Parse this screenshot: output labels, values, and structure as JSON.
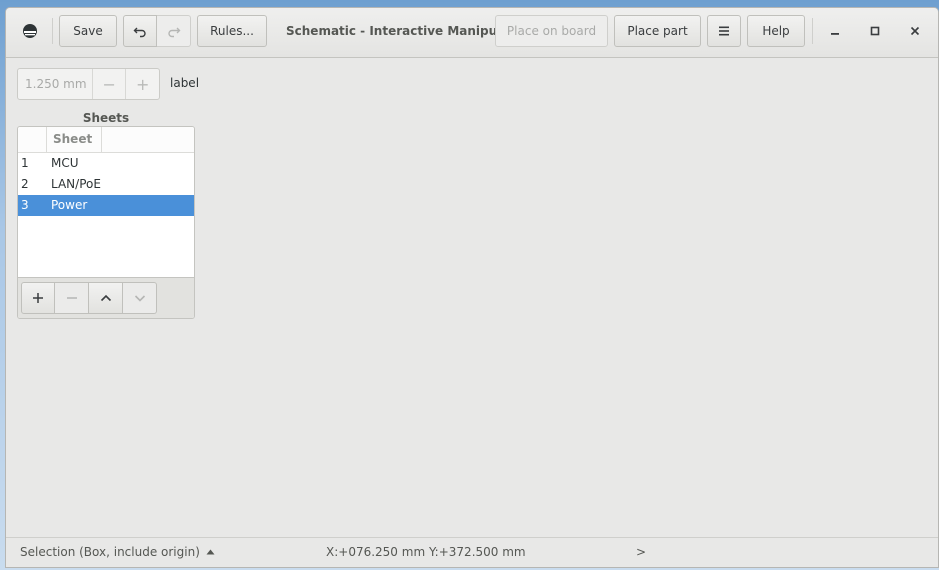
{
  "header": {
    "save_label": "Save",
    "rules_label": "Rules...",
    "title": "Schematic - Interactive Manipul...",
    "place_on_board_label": "Place on board",
    "place_part_label": "Place part",
    "help_label": "Help"
  },
  "toolbar": {
    "grid_value": "1.250 mm",
    "label_text": "label"
  },
  "sheets": {
    "title": "Sheets",
    "column_header": "Sheet",
    "rows": [
      {
        "num": "1",
        "name": "MCU"
      },
      {
        "num": "2",
        "name": "LAN/PoE"
      },
      {
        "num": "3",
        "name": "Power"
      }
    ],
    "selected_index": 2
  },
  "status": {
    "mode": "Selection (Box, include origin)",
    "coords": "X:+076.250 mm Y:+372.500 mm",
    "more": ">"
  },
  "colors": {
    "accent": "#4a90d9",
    "window_bg": "#e8e8e7"
  },
  "icons": {
    "app": "horizon-eda-icon",
    "undo": "undo-icon",
    "redo": "redo-icon",
    "menu": "hamburger-menu-icon",
    "minimize": "minimize-icon",
    "maximize": "maximize-icon",
    "close": "close-icon"
  }
}
